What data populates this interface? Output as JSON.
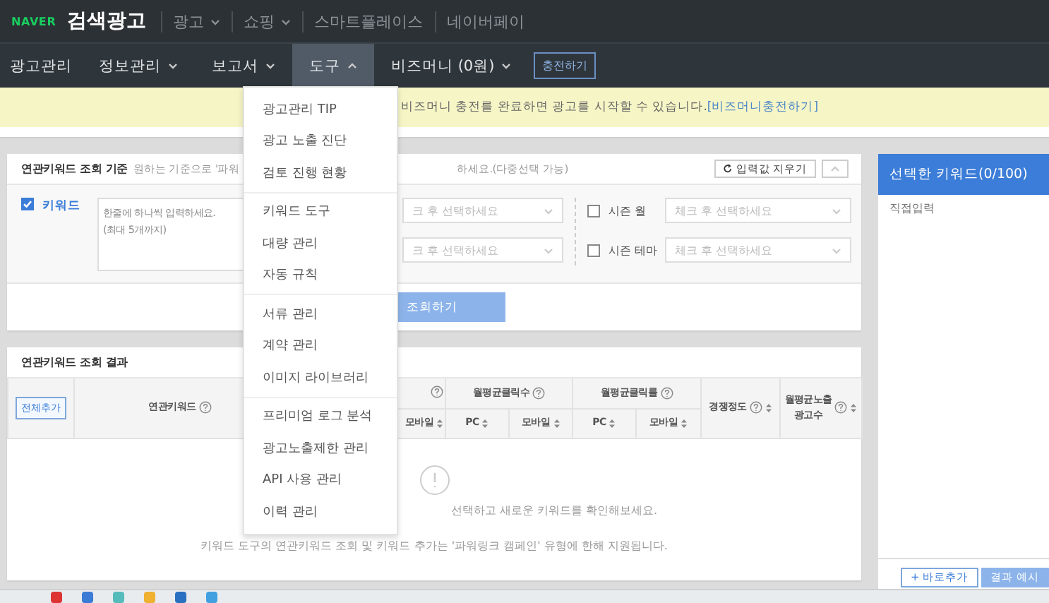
{
  "top_bar": {
    "logo": "NAVER",
    "title": "검색광고",
    "menu": [
      {
        "label": "광고",
        "caret": true
      },
      {
        "label": "쇼핑",
        "caret": true
      },
      {
        "label": "스마트플레이스",
        "caret": false
      },
      {
        "label": "네이버페이",
        "caret": false
      }
    ]
  },
  "nav": {
    "items": [
      {
        "label": "광고관리",
        "caret": false,
        "selected": false
      },
      {
        "label": "정보관리",
        "caret": true,
        "expanded": false,
        "selected": false
      },
      {
        "label": "보고서",
        "caret": true,
        "expanded": false,
        "selected": false
      },
      {
        "label": "도구",
        "caret": true,
        "expanded": true,
        "selected": true
      },
      {
        "label": "비즈머니 (0원)",
        "caret": true,
        "expanded": false,
        "selected": false
      }
    ],
    "charge_button": "충전하기"
  },
  "dropdown": {
    "groups": [
      {
        "items": [
          "광고관리 TIP",
          "광고 노출 진단",
          "검토 진행 현황"
        ]
      },
      {
        "items": [
          "키워드 도구",
          "대량 관리",
          "자동 규칙"
        ]
      },
      {
        "items": [
          "서류 관리",
          "계약 관리",
          "이미지 라이브러리"
        ]
      },
      {
        "items": [
          "프리미엄 로그 분석",
          "광고노출제한 관리",
          "API 사용 관리",
          "이력 관리"
        ]
      }
    ]
  },
  "notice": {
    "text": "비즈머니 충전를 완료하면 광고를 시작할 수 있습니다.",
    "link": "[비즈머니충전하기]"
  },
  "criteria": {
    "title": "연관키워드 조회 기준",
    "hint_start": "원하는 기준으로 '파워",
    "hint_end": "하세요.(다중선택 가능)",
    "reset_button": "입력값 지우기",
    "keyword": {
      "label": "키워드",
      "checked": true,
      "placeholder": "한줄에 하나씩 입력하세요.\n(최대 5개까지)"
    },
    "left_selects": [
      "크 후 선택하세요",
      "크 후 선택하세요"
    ],
    "season_filters": [
      {
        "label": "시즌 월",
        "checked": false,
        "placeholder": "체크 후 선택하세요"
      },
      {
        "label": "시즌 테마",
        "checked": false,
        "placeholder": "체크 후 선택하세요"
      }
    ],
    "search_button": "조회하기"
  },
  "results": {
    "title": "연관키워드 조회 결과",
    "add_all_button": "전체추가",
    "columns": [
      {
        "label": "연관키워드"
      },
      {
        "sub": [
          "모바일"
        ]
      },
      {
        "label": "월평균클릭수",
        "sub": [
          "PC",
          "모바일"
        ]
      },
      {
        "label": "월평균클릭률",
        "sub": [
          "PC",
          "모바일"
        ]
      },
      {
        "label": "경쟁정도"
      },
      {
        "label": "월평균노출\n광고수"
      }
    ],
    "empty_message": "선택하고 새로운 키워드를 확인해보세요.",
    "note": "키워드 도구의 연관키워드 조회 및 키워드 추가는 '파워링크 캠페인' 유형에 한해 지원됩니다."
  },
  "selected_panel": {
    "title": "선택한 키워드(0/100)",
    "direct_input": "직접입력",
    "add_button": "+ 바로추가",
    "preview_button": "결과 예시"
  }
}
